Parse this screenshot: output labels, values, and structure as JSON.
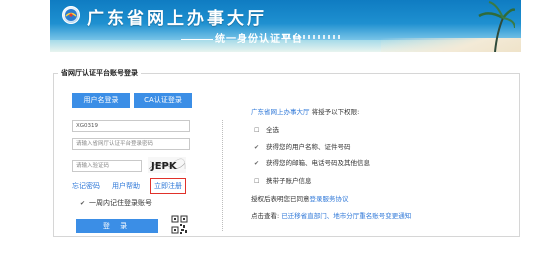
{
  "banner": {
    "title": "广东省网上办事大厅",
    "subtitle": "统一身份认证平台"
  },
  "panel": {
    "legend": "省网厅认证平台账号登录"
  },
  "tabs": {
    "user_login": "用户名登录",
    "ca_login": "CA认证登录"
  },
  "form": {
    "username_value": "XG0319",
    "password_placeholder": "请输入省网厅认证平台登录密码",
    "code_placeholder": "请输入验证码",
    "captcha_text": "JEPK"
  },
  "links": {
    "forgot": "忘记密码",
    "help": "用户帮助",
    "register": "立即注册"
  },
  "remember": {
    "label": "一周内记住登录账号",
    "checked": true
  },
  "login_button": "登 录",
  "auth": {
    "brand": "广东省网上办事大厅",
    "suffix": "将授予以下权限:",
    "permissions": [
      {
        "label": "全选",
        "checked": false
      },
      {
        "label": "获得您的用户名称、证件号码",
        "checked": true
      },
      {
        "label": "获得您的邮箱、电话号码及其他信息",
        "checked": true
      },
      {
        "label": "携带子账户信息",
        "checked": false
      }
    ],
    "terms_prefix": "授权后表明您已同意",
    "terms_link": "登录服务协议",
    "notice_prefix": "点击查看:",
    "notice_link": "已迁移省直部门、地市分厅重名账号变更通知"
  },
  "colors": {
    "primary_button": "#3b8ee6",
    "link": "#2f78d8",
    "register_border": "#e0312a",
    "banner_blue": "#0f7cc2"
  }
}
